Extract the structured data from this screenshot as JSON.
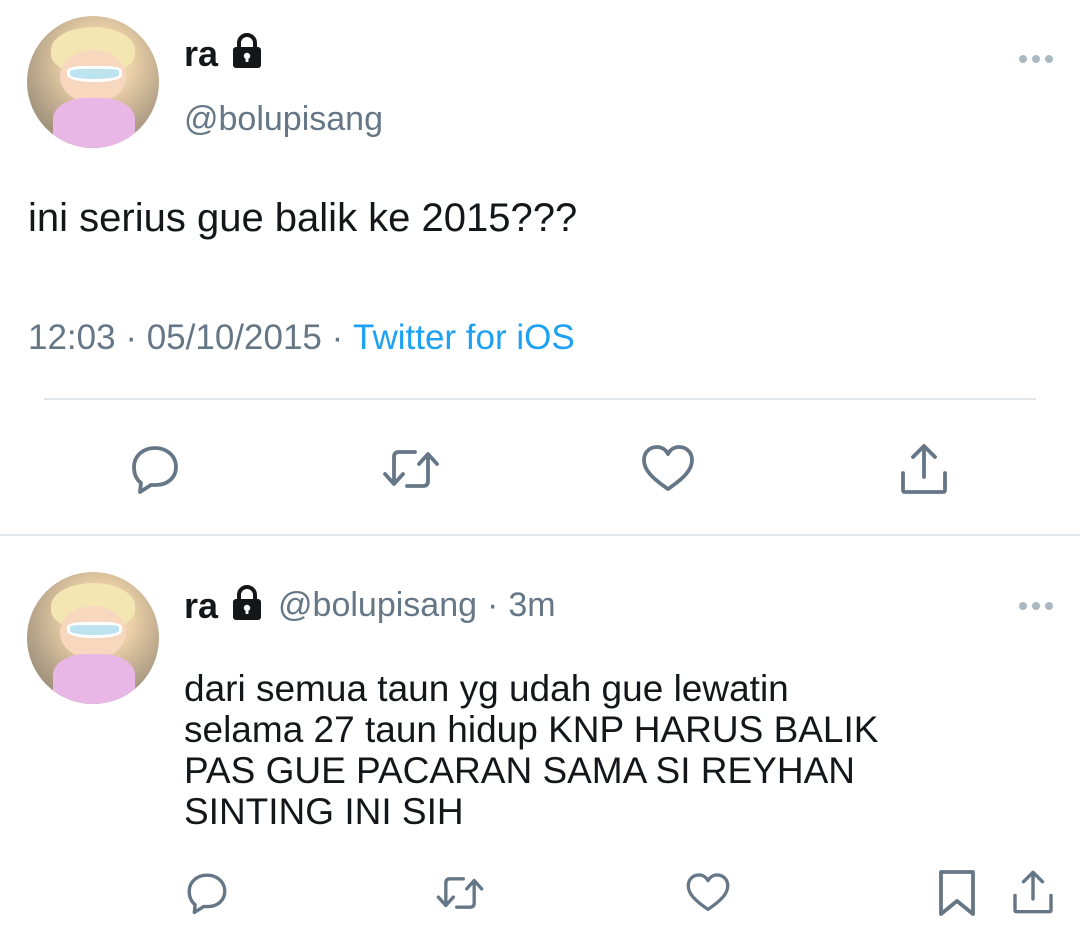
{
  "main_tweet": {
    "display_name": "ra",
    "handle": "@bolupisang",
    "text": "ini serius gue balik ke 2015???",
    "time": "12:03",
    "separator": "·",
    "date": "05/10/2015",
    "source": "Twitter for iOS",
    "icons": [
      "lock-icon",
      "more-icon",
      "reply-icon",
      "retweet-icon",
      "like-icon",
      "share-icon"
    ]
  },
  "reply_tweet": {
    "display_name": "ra",
    "handle": "@bolupisang",
    "separator": "·",
    "relative_time": "3m",
    "text_lines": [
      "dari semua taun yg udah gue lewatin",
      "selama 27 taun hidup KNP HARUS BALIK",
      "PAS GUE PACARAN SAMA SI REYHAN",
      "SINTING INI SIH"
    ],
    "icons": [
      "lock-icon",
      "more-icon",
      "reply-icon",
      "retweet-icon",
      "like-icon",
      "bookmark-icon",
      "share-icon"
    ]
  },
  "colors": {
    "text_primary": "#14171a",
    "text_secondary": "#657786",
    "link": "#1da1f2",
    "divider": "#e1e8ed"
  }
}
